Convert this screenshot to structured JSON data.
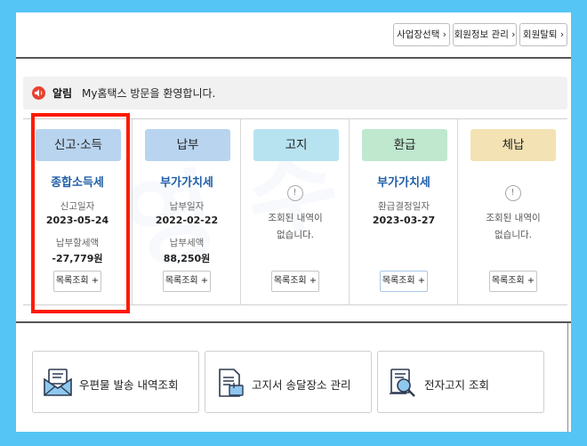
{
  "header": {
    "buttons": [
      "사업장선택 ›",
      "회원정보 관리 ›",
      "회원탈퇴 ›"
    ]
  },
  "alert": {
    "icon": "speaker-icon",
    "title": "알림",
    "text": "My홈택스 방문을 환영합니다."
  },
  "status": {
    "columns": [
      {
        "header": "신고·소득",
        "header_color": "#b9d4ef",
        "title": "종합소득세",
        "label1": "신고일자",
        "value1": "2023-05-24",
        "label2": "납부할세액",
        "value2": "-27,779원",
        "button": "목록조회 +"
      },
      {
        "header": "납부",
        "header_color": "#b9d4ef",
        "title": "부가가치세",
        "label1": "납부일자",
        "value1": "2022-02-22",
        "label2": "납부세액",
        "value2": "88,250원",
        "button": "목록조회 +"
      },
      {
        "header": "고지",
        "header_color": "#b7e3f0",
        "empty_text_1": "조회된 내역이",
        "empty_text_2": "없습니다.",
        "button": "목록조회 +"
      },
      {
        "header": "환급",
        "header_color": "#bfe8cf",
        "title": "부가가치세",
        "label1": "환급결정일자",
        "value1": "2023-03-27",
        "button": "목록조회 +"
      },
      {
        "header": "체납",
        "header_color": "#f3e2b3",
        "empty_text_1": "조회된 내역이",
        "empty_text_2": "없습니다.",
        "button": "목록조회 +"
      }
    ]
  },
  "services": [
    {
      "icon": "mail-history-icon",
      "label": "우편물 발송 내역조회"
    },
    {
      "icon": "document-location-icon",
      "label": "고지서 송달장소 관리"
    },
    {
      "icon": "electronic-notice-icon",
      "label": "전자고지 조회"
    }
  ],
  "colors": {
    "background": "#55c5f5",
    "highlight_border": "#ff1a05",
    "title_blue": "#1f5fa8"
  }
}
